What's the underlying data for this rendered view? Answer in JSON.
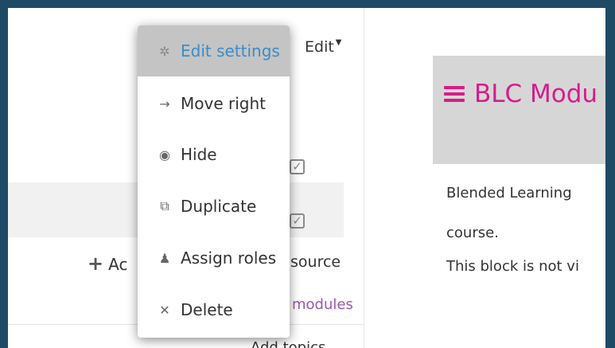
{
  "header": {
    "edit_label": "Edit"
  },
  "menu": {
    "items": [
      {
        "label": "Edit settings",
        "icon": "gear-icon"
      },
      {
        "label": "Move right",
        "icon": "arrow-right-icon"
      },
      {
        "label": "Hide",
        "icon": "eye-icon"
      },
      {
        "label": "Duplicate",
        "icon": "duplicate-icon"
      },
      {
        "label": "Assign roles",
        "icon": "assign-roles-icon"
      },
      {
        "label": "Delete",
        "icon": "close-icon"
      }
    ]
  },
  "section": {
    "add_activity_label": "Ac",
    "resource_label": "source",
    "modules_label": "modules",
    "add_topics_label": "Add topics"
  },
  "block": {
    "title": "BLC Modu",
    "line1": "Blended Learning",
    "line2": "course.",
    "line3": "This block is not vi"
  },
  "colors": {
    "accent": "#d61c8c",
    "link": "#3a8cc8",
    "modules": "#9a57b0",
    "frame": "#1f4a66"
  }
}
